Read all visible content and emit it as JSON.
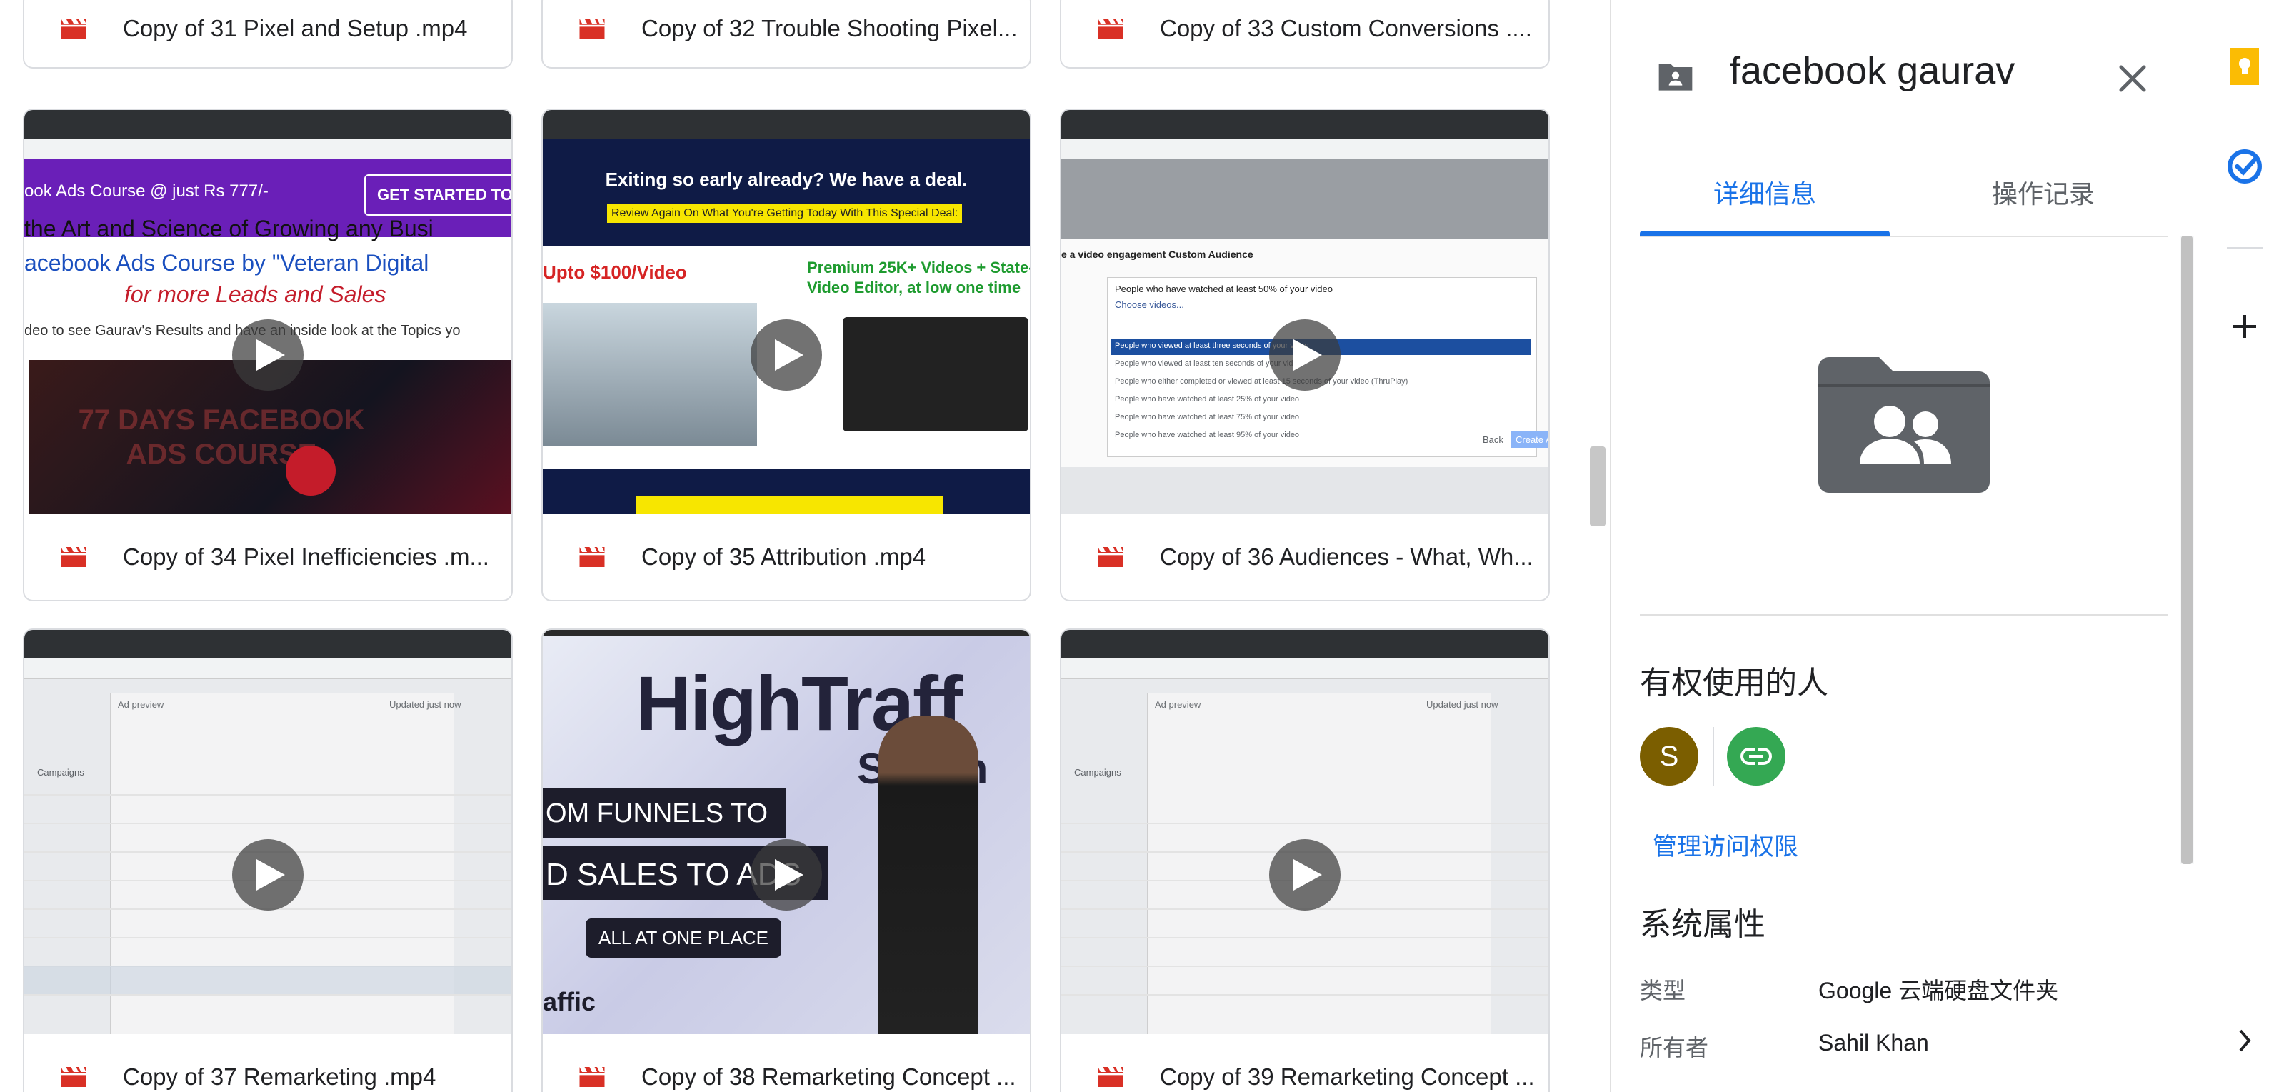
{
  "files": {
    "row1": [
      "Copy of 31 Pixel and Setup .mp4",
      "Copy of 32 Trouble Shooting Pixel...",
      "Copy of 33 Custom Conversions ...."
    ],
    "row2": [
      "Copy of 34 Pixel Inefficiencies .m...",
      "Copy of 35 Attribution .mp4",
      "Copy of 36 Audiences - What, Wh..."
    ],
    "row3": [
      "Copy of 37 Remarketing .mp4",
      "Copy of 38 Remarketing Concept ...",
      "Copy of 39 Remarketing Concept ..."
    ]
  },
  "thumbs": {
    "t34": {
      "banner": "ook Ads Course @ just Rs 777/-",
      "cta": "GET STARTED TO",
      "line1": "the Art and Science of Growing any Busi",
      "line2": "acebook Ads Course by \"Veteran Digital",
      "line3": "for more Leads and Sales",
      "line4": "deo to see Gaurav's Results and have an inside look at the Topics yo",
      "video_text": "77 DAYS FACEBOOK ADS COURSE"
    },
    "t35": {
      "headline": "Exiting so early already? We have a deal.",
      "subline": "Review Again On What You're Getting Today With This Special Deal:",
      "price": "Upto $100/Video",
      "premium": "Premium 25K+ Videos + State-",
      "premium2": "Video Editor, at low one time"
    },
    "t36": {
      "heading": "e a video engagement Custom Audience",
      "popup_title": "People who have watched at least 50% of your video",
      "choose": "Choose videos...",
      "options": [
        "People who viewed at least three seconds of your video",
        "People who viewed at least ten seconds of your video",
        "People who either completed or viewed at least 15 seconds of your video (ThruPlay)",
        "People who have watched at least 25% of your video",
        "People who have watched at least 75% of your video",
        "People who have watched at least 95% of your video"
      ],
      "back": "Back",
      "create": "Create A"
    },
    "t37": {
      "ad_preview": "Ad preview",
      "campaigns": "Campaigns",
      "updated": "Updated just now"
    },
    "t38": {
      "brand": "HighTraff",
      "sub": "Summ",
      "line1": "OM FUNNELS TO",
      "line2": "D SALES TO ADS",
      "badge": "ALL AT ONE PLACE",
      "footer": "affic"
    }
  },
  "panel": {
    "title": "facebook gaurav",
    "tabs": [
      "详细信息",
      "操作记录"
    ],
    "access_title": "有权使用的人",
    "avatar_letter": "S",
    "avatar_color": "#7b5e00",
    "link_color": "#34a853",
    "manage_access": "管理访问权限",
    "system_title": "系统属性",
    "properties": [
      {
        "key": "类型",
        "value": "Google 云端硬盘文件夹"
      },
      {
        "key": "所有者",
        "value": "Sahil Khan"
      }
    ]
  },
  "icons": {
    "file": "video-file-icon",
    "folder_shared": "shared-folder-icon",
    "close": "close-icon",
    "keep": "keep-icon",
    "tasks": "tasks-icon",
    "add": "add-icon",
    "expand": "chevron-right-icon"
  },
  "colors": {
    "accent": "#1a73e8",
    "video_icon": "#d93025",
    "keep": "#fbbc04"
  }
}
